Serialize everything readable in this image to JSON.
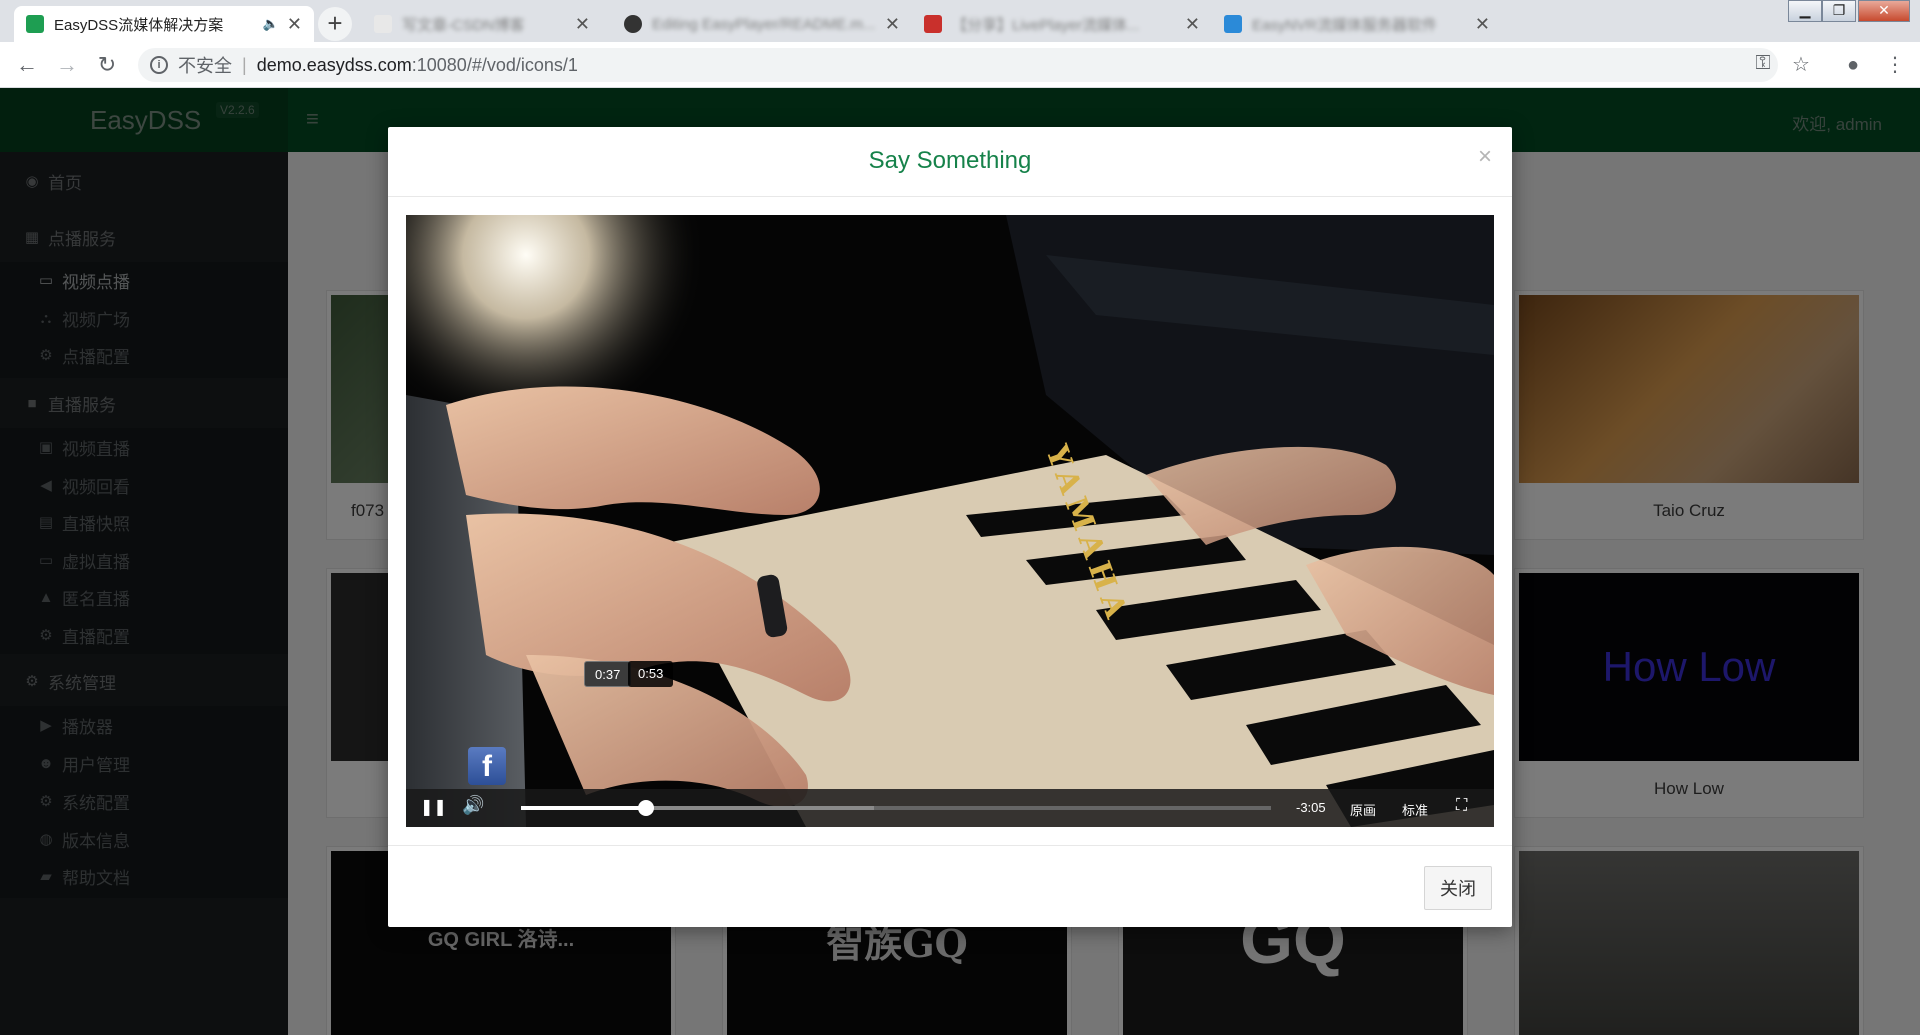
{
  "browser": {
    "tabs": [
      {
        "title": "EasyDSS流媒体解决方案",
        "active": true
      },
      {
        "title": "写文章-CSDN博客",
        "active": false
      },
      {
        "title": "Editing EasyPlayer/README.m...",
        "active": false
      },
      {
        "title": "【分享】LivePlayer流媒体...",
        "active": false
      },
      {
        "title": "EasyNVR流媒体服务器软件",
        "active": false
      }
    ],
    "new_tab": "+",
    "address": {
      "security_label": "不安全",
      "host": "demo.easydss.com",
      "path": ":10080/#/vod/icons/1"
    }
  },
  "app": {
    "brand": "EasyDSS",
    "version": "V2.2.6",
    "welcome": "欢迎, admin"
  },
  "sidebar": {
    "groups": [
      {
        "label": "首页",
        "icon": "dashboard-icon"
      },
      {
        "label": "点播服务",
        "icon": "table-icon",
        "items": [
          {
            "label": "视频点播",
            "icon": "desktop-icon",
            "active": true
          },
          {
            "label": "视频广场",
            "icon": "binoculars-icon"
          },
          {
            "label": "点播配置",
            "icon": "gear-icon"
          }
        ]
      },
      {
        "label": "直播服务",
        "icon": "video-camera-icon",
        "items": [
          {
            "label": "视频直播",
            "icon": "play-square-icon"
          },
          {
            "label": "视频回看",
            "icon": "backward-icon"
          },
          {
            "label": "直播快照",
            "icon": "image-icon"
          },
          {
            "label": "虚拟直播",
            "icon": "laptop-icon"
          },
          {
            "label": "匿名直播",
            "icon": "lock-icon"
          },
          {
            "label": "直播配置",
            "icon": "gear-icon"
          }
        ]
      },
      {
        "label": "系统管理",
        "icon": "gears-icon",
        "items": [
          {
            "label": "播放器",
            "icon": "play-circle-icon"
          },
          {
            "label": "用户管理",
            "icon": "users-icon"
          },
          {
            "label": "系统配置",
            "icon": "gear-icon"
          },
          {
            "label": "版本信息",
            "icon": "globe-icon"
          },
          {
            "label": "帮助文档",
            "icon": "book-icon"
          }
        ]
      }
    ]
  },
  "cards": {
    "row1_left_title": "f073",
    "row1_right_title": "Taio Cruz",
    "row2_right_title": "How Low",
    "row2_right_thumb_text": "How Low",
    "row3_thumb_texts": [
      "GQ GIRL 洛诗...",
      "智族GQ",
      "GQ"
    ]
  },
  "modal": {
    "title": "Say Something",
    "close_x": "×",
    "close_button": "关闭",
    "player": {
      "hover_time": "0:37",
      "buffer_time": "0:53",
      "remaining": "-3:05",
      "quality_original": "原画",
      "quality_standard": "标准",
      "progress_percent": 16.7,
      "loaded_percent": 47,
      "overlay_logo": "f"
    }
  },
  "colors": {
    "accent": "#16824a",
    "header": "#034a22",
    "sidebar": "#1a1e20"
  }
}
